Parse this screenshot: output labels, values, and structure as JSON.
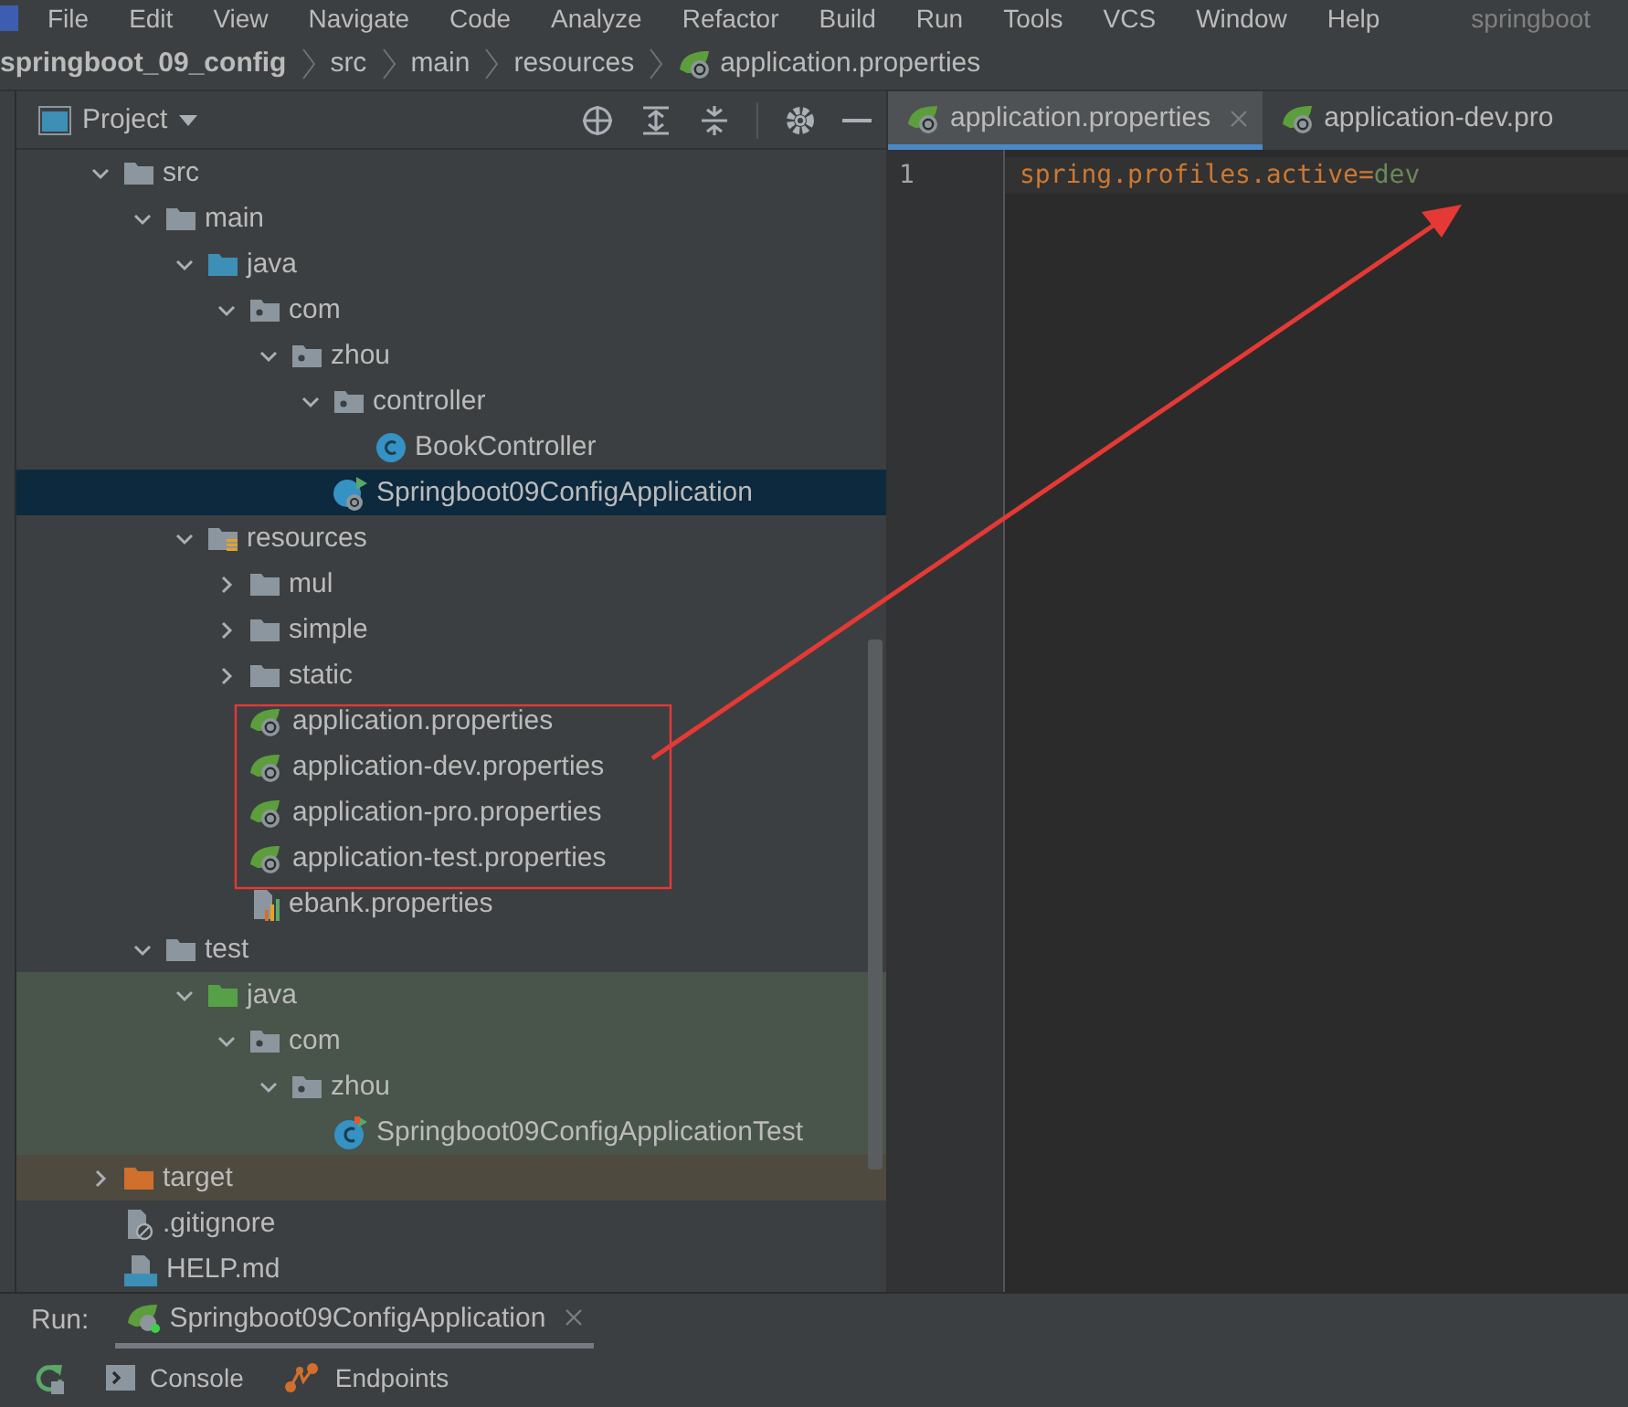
{
  "menu_bar": {
    "items": [
      "File",
      "Edit",
      "View",
      "Navigate",
      "Code",
      "Analyze",
      "Refactor",
      "Build",
      "Run",
      "Tools",
      "VCS",
      "Window",
      "Help"
    ],
    "title": "springboot"
  },
  "breadcrumb": [
    {
      "label": "springboot_09_config",
      "kind": "project"
    },
    {
      "label": "src",
      "kind": "folder"
    },
    {
      "label": "main",
      "kind": "folder"
    },
    {
      "label": "resources",
      "kind": "folder"
    },
    {
      "label": "application.properties",
      "kind": "file"
    }
  ],
  "project_panel": {
    "title": "Project",
    "tree": [
      {
        "label": "src",
        "kind": "folder",
        "expanded": true,
        "selected": false,
        "children": [
          {
            "label": "main",
            "kind": "folder",
            "expanded": true,
            "selected": false,
            "children": [
              {
                "label": "java",
                "kind": "source-folder",
                "expanded": true,
                "selected": false,
                "children": [
                  {
                    "label": "com",
                    "kind": "package",
                    "expanded": true,
                    "selected": false,
                    "children": [
                      {
                        "label": "zhou",
                        "kind": "package",
                        "expanded": true,
                        "selected": false,
                        "children": [
                          {
                            "label": "controller",
                            "kind": "package",
                            "expanded": true,
                            "selected": false,
                            "children": [
                              {
                                "label": "BookController",
                                "kind": "class",
                                "selected": false
                              }
                            ]
                          },
                          {
                            "label": "Springboot09ConfigApplication",
                            "kind": "spring-app",
                            "selected": true
                          }
                        ]
                      }
                    ]
                  }
                ]
              },
              {
                "label": "resources",
                "kind": "resources-folder",
                "expanded": true,
                "selected": false,
                "children": [
                  {
                    "label": "mul",
                    "kind": "folder",
                    "expanded": false,
                    "selected": false
                  },
                  {
                    "label": "simple",
                    "kind": "folder",
                    "expanded": false,
                    "selected": false
                  },
                  {
                    "label": "static",
                    "kind": "folder",
                    "expanded": false,
                    "selected": false
                  },
                  {
                    "label": "application.properties",
                    "kind": "spring-properties",
                    "selected": false
                  },
                  {
                    "label": "application-dev.properties",
                    "kind": "spring-properties",
                    "selected": false
                  },
                  {
                    "label": "application-pro.properties",
                    "kind": "spring-properties",
                    "selected": false
                  },
                  {
                    "label": "application-test.properties",
                    "kind": "spring-properties",
                    "selected": false
                  },
                  {
                    "label": "ebank.properties",
                    "kind": "properties",
                    "selected": false
                  }
                ]
              }
            ]
          },
          {
            "label": "test",
            "kind": "folder",
            "expanded": true,
            "selected": false,
            "children": [
              {
                "label": "java",
                "kind": "test-source-folder",
                "expanded": true,
                "selected": false,
                "children": [
                  {
                    "label": "com",
                    "kind": "test-package",
                    "expanded": true,
                    "selected": false,
                    "children": [
                      {
                        "label": "zhou",
                        "kind": "test-package",
                        "expanded": true,
                        "selected": false,
                        "children": [
                          {
                            "label": "Springboot09ConfigApplicationTest",
                            "kind": "test-class",
                            "selected": false
                          }
                        ]
                      }
                    ]
                  }
                ]
              }
            ]
          }
        ]
      },
      {
        "label": "target",
        "kind": "excluded-folder",
        "expanded": false,
        "selected": false
      },
      {
        "label": ".gitignore",
        "kind": "gitignore",
        "selected": false
      },
      {
        "label": "HELP.md",
        "kind": "markdown",
        "selected": false
      }
    ]
  },
  "editor": {
    "tabs": [
      {
        "label": "application.properties",
        "selected": true
      },
      {
        "label": "application-dev.pro",
        "selected": false
      }
    ],
    "lines": [
      {
        "number": "1",
        "key": "spring.profiles.active",
        "separator": "=",
        "value": "dev"
      }
    ]
  },
  "annotation": {
    "kind": "box-with-arrow"
  },
  "run_bar": {
    "label": "Run:",
    "tab": "Springboot09ConfigApplication"
  },
  "bottom_tabs": [
    {
      "label": "Console",
      "kind": "console"
    },
    {
      "label": "Endpoints",
      "kind": "endpoints"
    }
  ]
}
